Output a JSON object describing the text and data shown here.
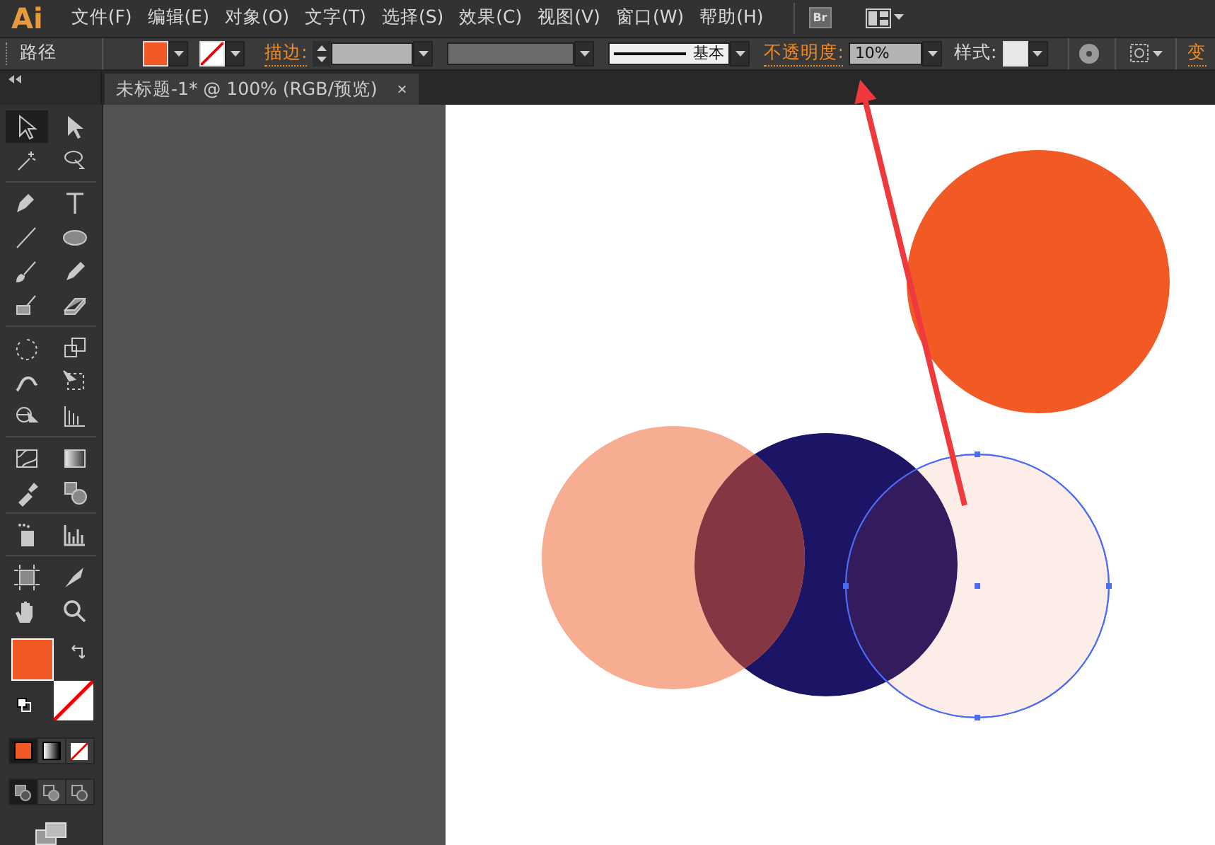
{
  "app": {
    "logo": "Ai"
  },
  "menu": [
    {
      "label": "文件(F)"
    },
    {
      "label": "编辑(E)"
    },
    {
      "label": "对象(O)"
    },
    {
      "label": "文字(T)"
    },
    {
      "label": "选择(S)"
    },
    {
      "label": "效果(C)"
    },
    {
      "label": "视图(V)"
    },
    {
      "label": "窗口(W)"
    },
    {
      "label": "帮助(H)"
    }
  ],
  "bridge_button": "Br",
  "control_bar": {
    "selection_label": "路径",
    "fill": {
      "color": "#f15a24"
    },
    "stroke_none": true,
    "stroke_label": "描边:",
    "stroke_profile": "基本",
    "opacity_label": "不透明度:",
    "opacity_value": "10%",
    "style_label": "样式:",
    "transform_label": "变"
  },
  "document_tab": {
    "title": "未标题-1* @ 100% (RGB/预览)",
    "close": "×",
    "selected": true
  },
  "tools": [
    {
      "kind": "selection",
      "selected": true
    },
    {
      "kind": "direct",
      "selected": false
    },
    {
      "kind": "wand",
      "selected": false
    },
    {
      "kind": "lasso",
      "selected": false
    },
    {
      "kind": "sep"
    },
    {
      "kind": "pen",
      "selected": false
    },
    {
      "kind": "type",
      "selected": false
    },
    {
      "kind": "line",
      "selected": false
    },
    {
      "kind": "ellipse",
      "selected": false
    },
    {
      "kind": "brush",
      "selected": false
    },
    {
      "kind": "pencil",
      "selected": false
    },
    {
      "kind": "blob",
      "selected": false
    },
    {
      "kind": "eraser",
      "selected": false
    },
    {
      "kind": "sep"
    },
    {
      "kind": "rotate",
      "selected": false
    },
    {
      "kind": "scale",
      "selected": false
    },
    {
      "kind": "warp",
      "selected": false
    },
    {
      "kind": "freetransform",
      "selected": false
    },
    {
      "kind": "shapebuilder",
      "selected": false
    },
    {
      "kind": "graph3",
      "selected": false
    },
    {
      "kind": "sep"
    },
    {
      "kind": "mesh",
      "selected": false
    },
    {
      "kind": "gradient",
      "selected": false
    },
    {
      "kind": "eyedropper",
      "selected": false
    },
    {
      "kind": "blend",
      "selected": false
    },
    {
      "kind": "sep"
    },
    {
      "kind": "spray",
      "selected": false
    },
    {
      "kind": "chart",
      "selected": false
    },
    {
      "kind": "sep"
    },
    {
      "kind": "artboard",
      "selected": false
    },
    {
      "kind": "slice",
      "selected": false
    },
    {
      "kind": "hand",
      "selected": false
    },
    {
      "kind": "zoom",
      "selected": false
    }
  ],
  "color_modes": [
    {
      "kind": "color",
      "selected": true
    },
    {
      "kind": "gradient",
      "selected": false
    },
    {
      "kind": "none",
      "selected": false
    }
  ],
  "draw_modes": [
    {
      "selected": true
    },
    {
      "selected": false
    },
    {
      "selected": false
    }
  ],
  "shapes": [
    {
      "color": "#1c1464",
      "selected": false
    },
    {
      "color": "#f7ad92",
      "selected": false
    },
    {
      "color": "#f15a24",
      "selected": false
    },
    {
      "color": "#fdede8",
      "selected": true
    }
  ]
}
